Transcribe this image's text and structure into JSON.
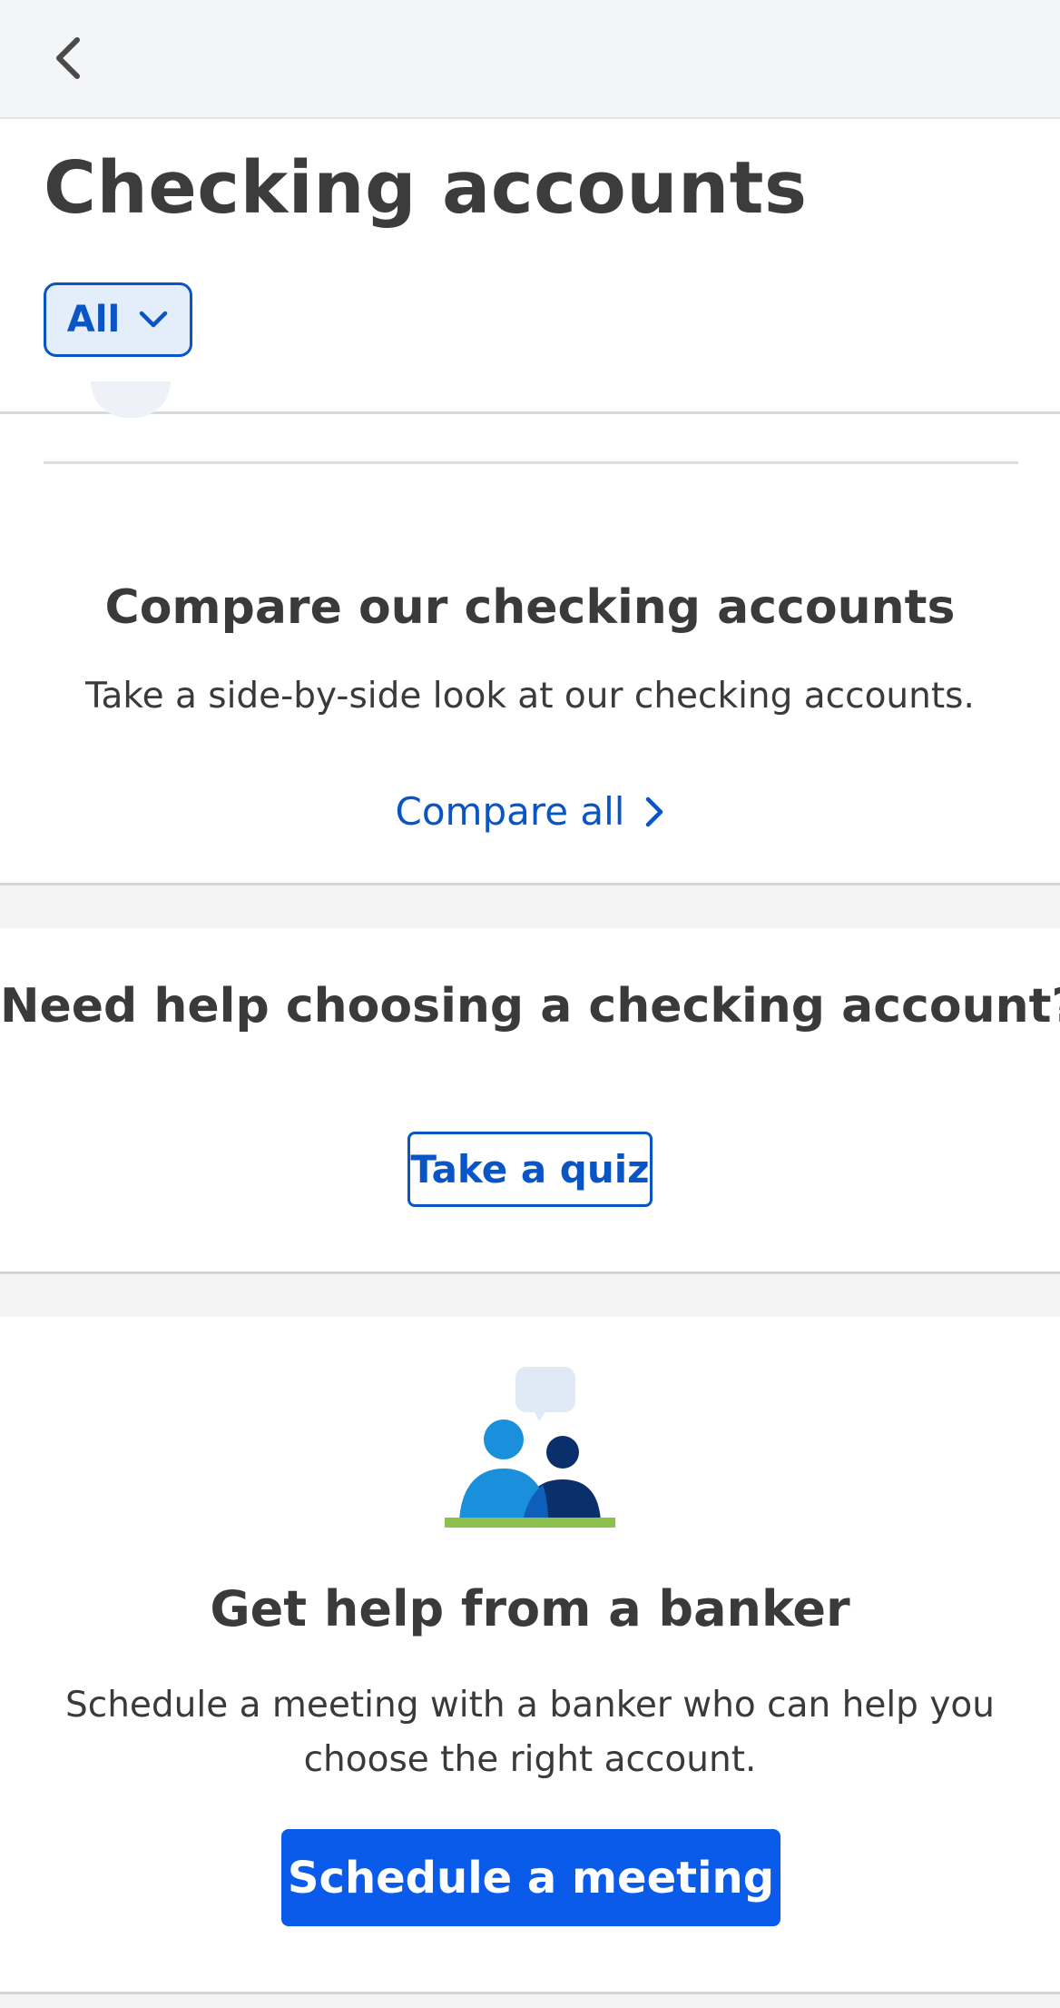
{
  "header": {
    "title": "Checking accounts",
    "filter": {
      "selected": "All",
      "icon": "chevron-down-icon"
    },
    "back_icon": "chevron-left-icon"
  },
  "compare": {
    "title": "Compare our checking accounts",
    "description": "Take a side-by-side look at our checking accounts.",
    "link_label": "Compare all",
    "link_icon": "chevron-right-icon"
  },
  "quiz": {
    "title": "Need help choosing a checking account?",
    "button_label": "Take a quiz"
  },
  "banker": {
    "illustration": "people-chat-illustration",
    "title": "Get help from a banker",
    "description": "Schedule a meeting with a banker who can help you choose the right account.",
    "button_label": "Schedule a meeting"
  },
  "colors": {
    "accent": "#0a55c6",
    "primary_button": "#0a5bea",
    "text": "#3a3a3a",
    "illustration_light_blue": "#1a8fdc",
    "illustration_dark_blue": "#0b2f6b",
    "illustration_green": "#8dc04f"
  }
}
